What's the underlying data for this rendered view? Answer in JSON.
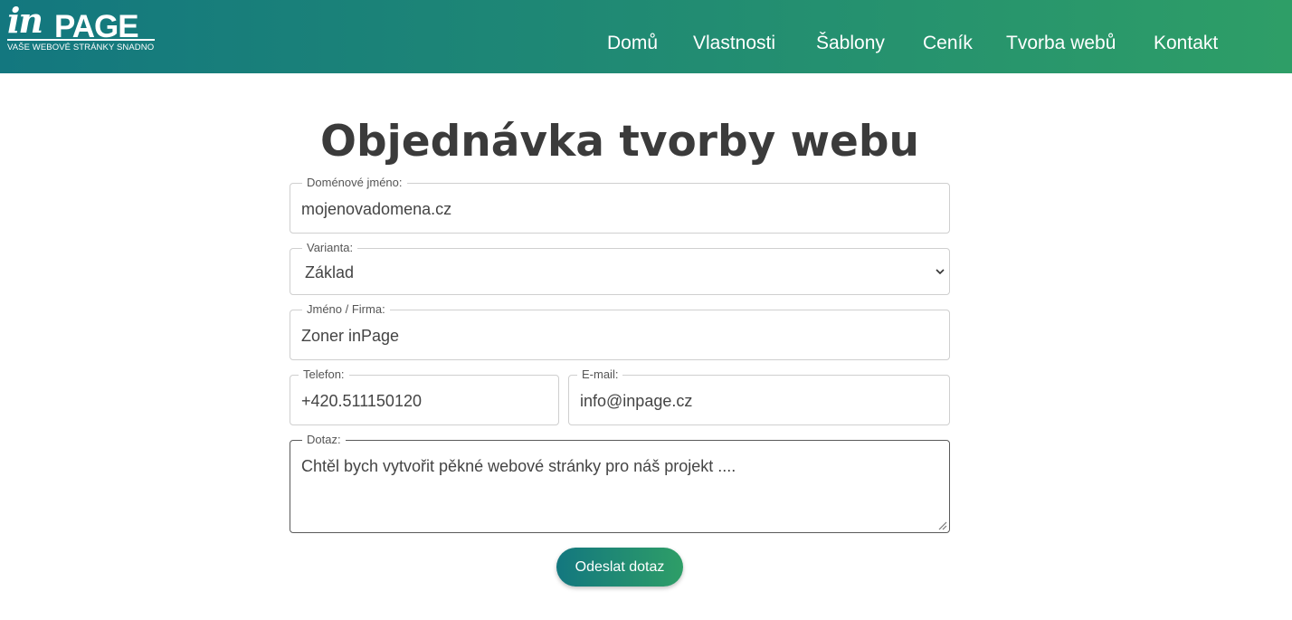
{
  "header": {
    "logo": {
      "in": "in",
      "page": "PAGE",
      "tagline": "VAŠE WEBOVÉ STRÁNKY SNADNO"
    },
    "nav": [
      "Domů",
      "Vlastnosti",
      "Šablony",
      "Ceník",
      "Tvorba webů",
      "Kontakt"
    ],
    "gradient_start": "#13777f",
    "gradient_end": "#2e9e67"
  },
  "form": {
    "title": "Objednávka tvorby webu",
    "domain": {
      "label": "Doménové jméno:",
      "value": "mojenovadomena.cz"
    },
    "variant": {
      "label": "Varianta:",
      "value": "Základ"
    },
    "name": {
      "label": "Jméno / Firma:",
      "value": "Zoner inPage"
    },
    "phone": {
      "label": "Telefon:",
      "value": "+420.511150120"
    },
    "email": {
      "label": "E-mail:",
      "value": "info@inpage.cz"
    },
    "question": {
      "label": "Dotaz:",
      "value": "Chtěl bych vytvořit pěkné webové stránky pro náš projekt ...."
    },
    "submit_label": "Odeslat dotaz"
  }
}
